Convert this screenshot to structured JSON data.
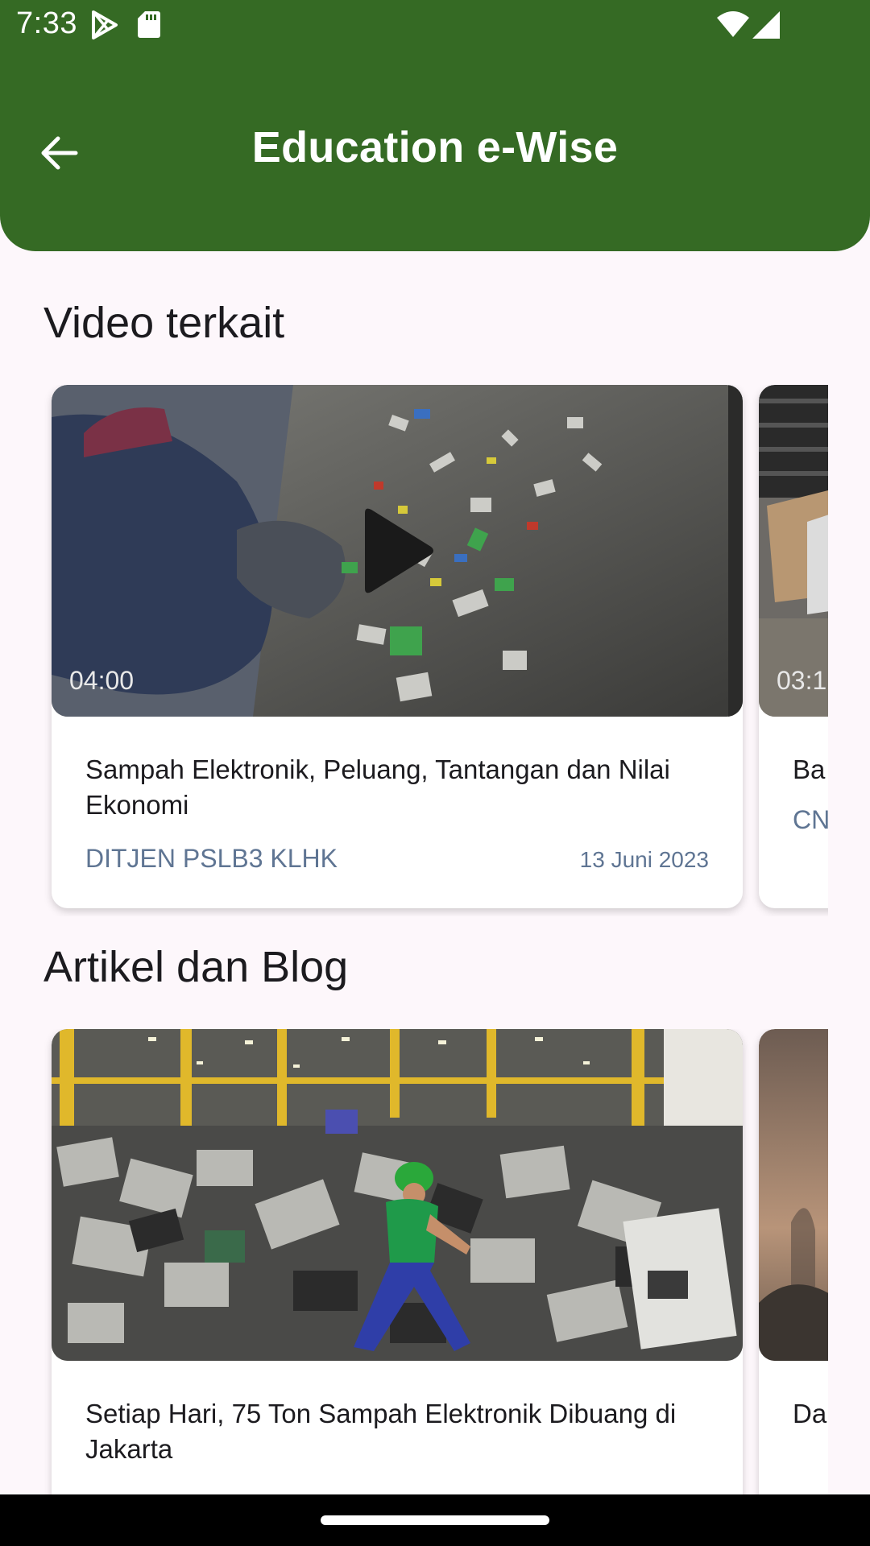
{
  "status_bar": {
    "time": "7:33"
  },
  "app_bar": {
    "title": "Education e-Wise"
  },
  "sections": {
    "videos": {
      "title": "Video terkait",
      "items": [
        {
          "duration": "04:00",
          "title": "Sampah Elektronik, Peluang, Tantangan dan Nilai Ekonomi",
          "source": "DITJEN PSLB3 KLHK",
          "date": "13 Juni 2023"
        },
        {
          "duration": "03:1",
          "title": "Ba",
          "source": "CN",
          "date": ""
        }
      ]
    },
    "articles": {
      "title": "Artikel dan Blog",
      "items": [
        {
          "title": "Setiap Hari, 75 Ton Sampah Elektronik Dibuang di Jakarta"
        },
        {
          "title": "Da Wo"
        }
      ]
    }
  },
  "colors": {
    "header": "#356a24",
    "background": "#fdf7fb",
    "meta_text": "#5f7593"
  }
}
